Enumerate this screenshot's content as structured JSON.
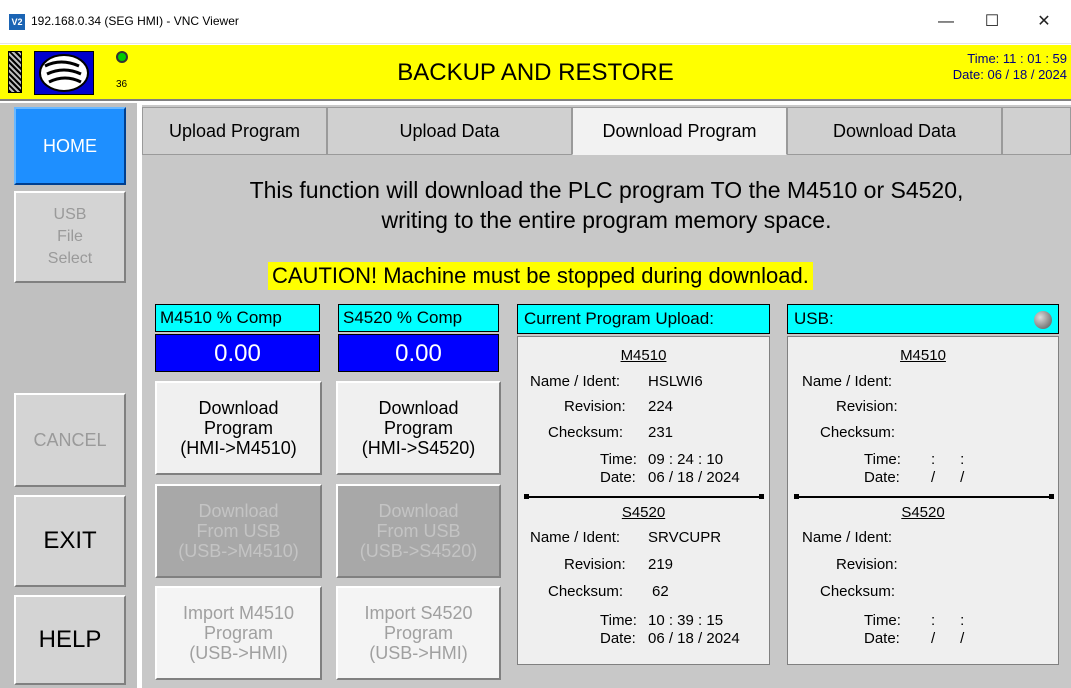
{
  "window": {
    "icon_label": "V2",
    "title": "192.168.0.34 (SEG HMI) - VNC Viewer",
    "min": "—",
    "max": "☐",
    "close": "✕"
  },
  "header": {
    "title": "BACKUP AND RESTORE",
    "status_number": "36",
    "time": "Time: 11 : 01 : 59",
    "date": "Date: 06 / 18 / 2024",
    "led_color": "#00cc00",
    "bg_color": "#ffff00"
  },
  "nav": {
    "home": "HOME",
    "usb_file_select": [
      "USB",
      "File",
      "Select"
    ],
    "cancel": "CANCEL",
    "exit": "EXIT",
    "help": "HELP"
  },
  "tabs": [
    {
      "label": "Upload Program",
      "selected": false
    },
    {
      "label": "Upload Data",
      "selected": false
    },
    {
      "label": "Download Program",
      "selected": true
    },
    {
      "label": "Download Data",
      "selected": false
    }
  ],
  "description": {
    "line1": "This function will download the PLC program TO the M4510 or S4520,",
    "line2": "writing to the entire program memory space."
  },
  "caution": "CAUTION! Machine must be stopped during download.",
  "m4510": {
    "label": "M4510 % Comp",
    "value": "0.00",
    "download_btn": [
      "Download",
      "Program",
      "(HMI->M4510)"
    ],
    "from_usb_btn": [
      "Download",
      "From USB",
      "(USB->M4510)"
    ],
    "import_btn": [
      "Import M4510",
      "Program",
      "(USB->HMI)"
    ]
  },
  "s4520": {
    "label": "S4520 % Comp",
    "value": "0.00",
    "download_btn": [
      "Download",
      "Program",
      "(HMI->S4520)"
    ],
    "from_usb_btn": [
      "Download",
      "From USB",
      "(USB->S4520)"
    ],
    "import_btn": [
      "Import S4520",
      "Program",
      "(USB->HMI)"
    ]
  },
  "current_upload": {
    "header": "Current Program Upload:",
    "labels": {
      "name": "Name / Ident:",
      "revision": "Revision:",
      "checksum": "Checksum:",
      "time": "Time:",
      "date": "Date:"
    },
    "m4510": {
      "title": "M4510",
      "name": "HSLWI6",
      "revision": "224",
      "checksum": "231",
      "time": "09 : 24 : 10",
      "date": "06 / 18 / 2024"
    },
    "s4520": {
      "title": "S4520",
      "name": "SRVCUPR",
      "revision": "219",
      "checksum": "62",
      "time": "10 : 39 : 15",
      "date": "06 / 18 / 2024"
    }
  },
  "usb": {
    "header": "USB:",
    "m4510": {
      "title": "M4510",
      "time": ":      :",
      "date": "/      /"
    },
    "s4520": {
      "title": "S4520",
      "time": ":      :",
      "date": "/      /"
    }
  }
}
